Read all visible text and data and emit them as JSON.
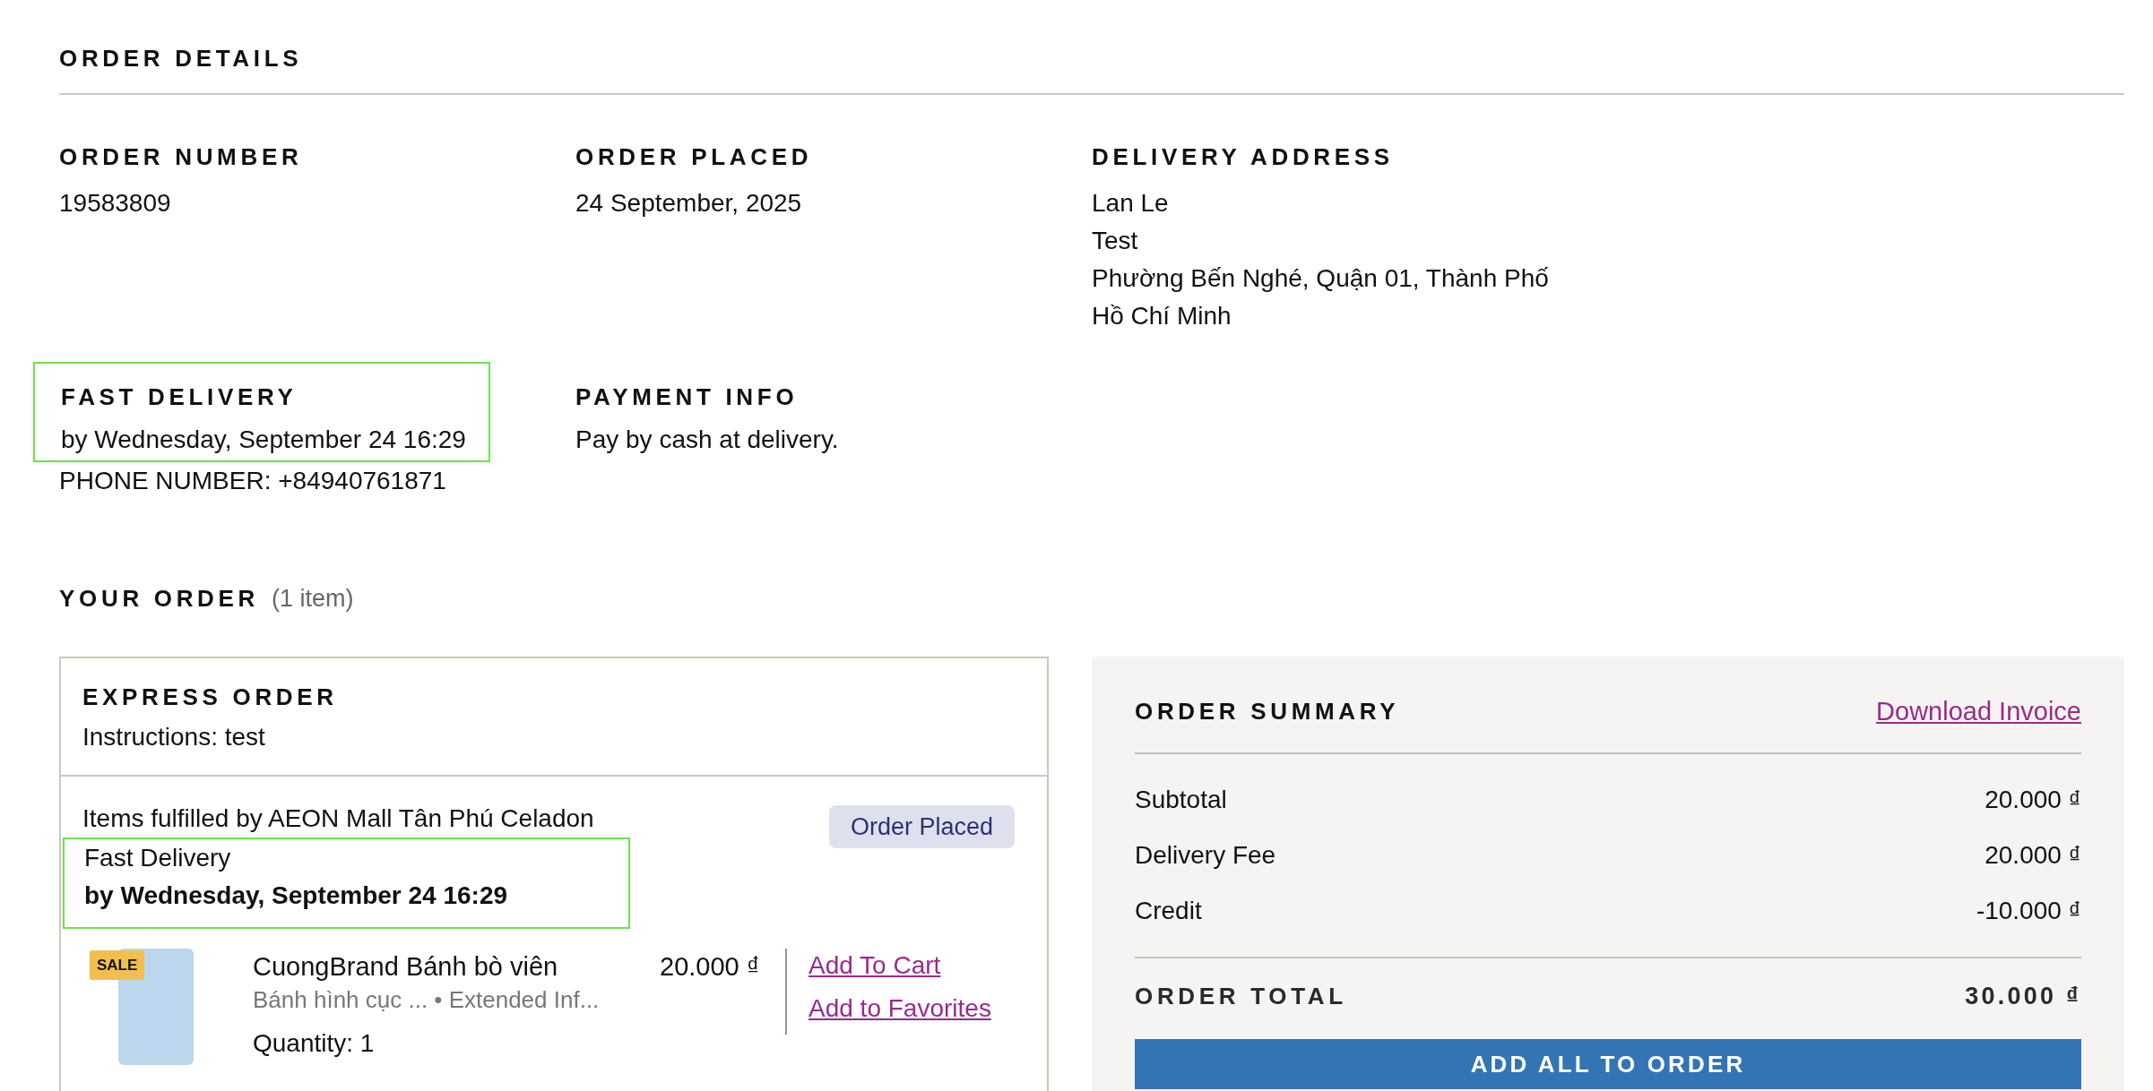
{
  "page_title": "ORDER DETAILS",
  "details": [
    {
      "label": "ORDER NUMBER",
      "lines": [
        "19583809"
      ]
    },
    {
      "label": "ORDER PLACED",
      "lines": [
        "24 September, 2025"
      ]
    },
    {
      "label": "DELIVERY ADDRESS",
      "lines": [
        "Lan Le",
        "Test",
        "Phường Bến Nghé, Quận 01, Thành Phố",
        "Hồ Chí Minh"
      ]
    }
  ],
  "delivery": {
    "label": "FAST DELIVERY",
    "value": "by Wednesday, September 24 16:29",
    "highlighted": true,
    "phone": "PHONE NUMBER: +84940761871"
  },
  "payment": {
    "label": "PAYMENT INFO",
    "value": "Pay by cash at delivery."
  },
  "your_order": {
    "title": "YOUR ORDER",
    "count": "(1 item)"
  },
  "order_box": {
    "type_label": "EXPRESS ORDER",
    "instructions": "Instructions: test",
    "fulfilled_by": "Items fulfilled by AEON Mall Tân Phú Celadon",
    "status": "Order Placed",
    "delivery_type": "Fast Delivery",
    "delivery_time": "by Wednesday, September 24 16:29",
    "highlighted": true,
    "items": [
      {
        "badge": "SALE",
        "name": "CuongBrand Bánh bò viên",
        "details": "Bánh hình cục ... • Extended Inf...",
        "quantity": "Quantity: 1",
        "price": "20.000 ₫",
        "links": [
          "Add To Cart",
          "Add to Favorites"
        ]
      }
    ]
  },
  "summary": {
    "title": "ORDER SUMMARY",
    "link": "Download Invoice",
    "rows": [
      {
        "label": "Subtotal",
        "value": "20.000 ₫"
      },
      {
        "label": "Delivery Fee",
        "value": "20.000 ₫"
      },
      {
        "label": "Credit",
        "value": "-10.000 ₫"
      }
    ],
    "total_label": "ORDER TOTAL",
    "total_value": "30.000 ₫",
    "button": "ADD ALL TO ORDER"
  }
}
